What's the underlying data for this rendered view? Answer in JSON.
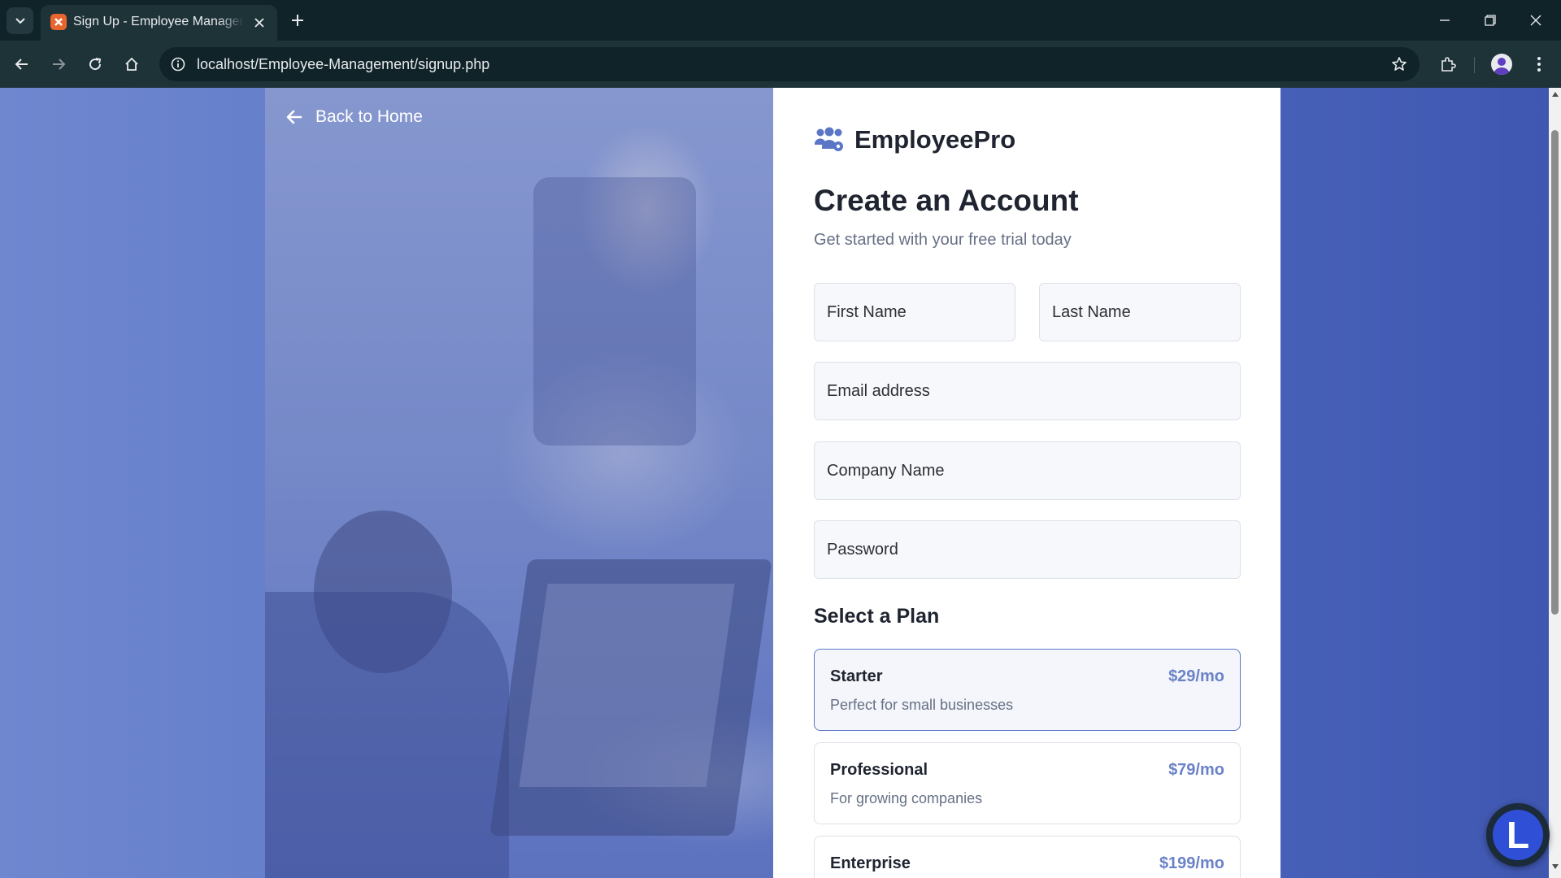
{
  "browser": {
    "tab_title": "Sign Up - Employee Management",
    "url": "localhost/Employee-Management/signup.php",
    "icons": [
      "tab-search-icon",
      "xampp-favicon-icon",
      "close-icon",
      "plus-icon",
      "minimize-icon",
      "restore-icon",
      "close-window-icon",
      "back-arrow-icon",
      "forward-arrow-icon",
      "reload-icon",
      "home-icon",
      "info-icon",
      "star-icon",
      "extensions-icon",
      "profile-icon",
      "kebab-menu-icon"
    ]
  },
  "page": {
    "back_link": "Back to Home",
    "brand": {
      "name": "EmployeePro",
      "icon": "users-gear-icon",
      "color": "#5b76c6"
    },
    "heading": "Create an Account",
    "subtitle": "Get started with your free trial today",
    "form": {
      "first_name_placeholder": "First Name",
      "last_name_placeholder": "Last Name",
      "email_placeholder": "Email address",
      "company_placeholder": "Company Name",
      "password_placeholder": "Password"
    },
    "plans_heading": "Select a Plan",
    "plans": [
      {
        "name": "Starter",
        "price": "$29/mo",
        "description": "Perfect for small businesses",
        "selected": true
      },
      {
        "name": "Professional",
        "price": "$79/mo",
        "description": "For growing companies",
        "selected": false
      },
      {
        "name": "Enterprise",
        "price": "$199/mo",
        "description": "",
        "selected": false
      }
    ],
    "widget_letter": "L"
  },
  "colors": {
    "accent": "#5b76c6",
    "price": "#6b82c8",
    "chrome_dark": "#0f2329",
    "chrome_toolbar": "#1e3338"
  }
}
